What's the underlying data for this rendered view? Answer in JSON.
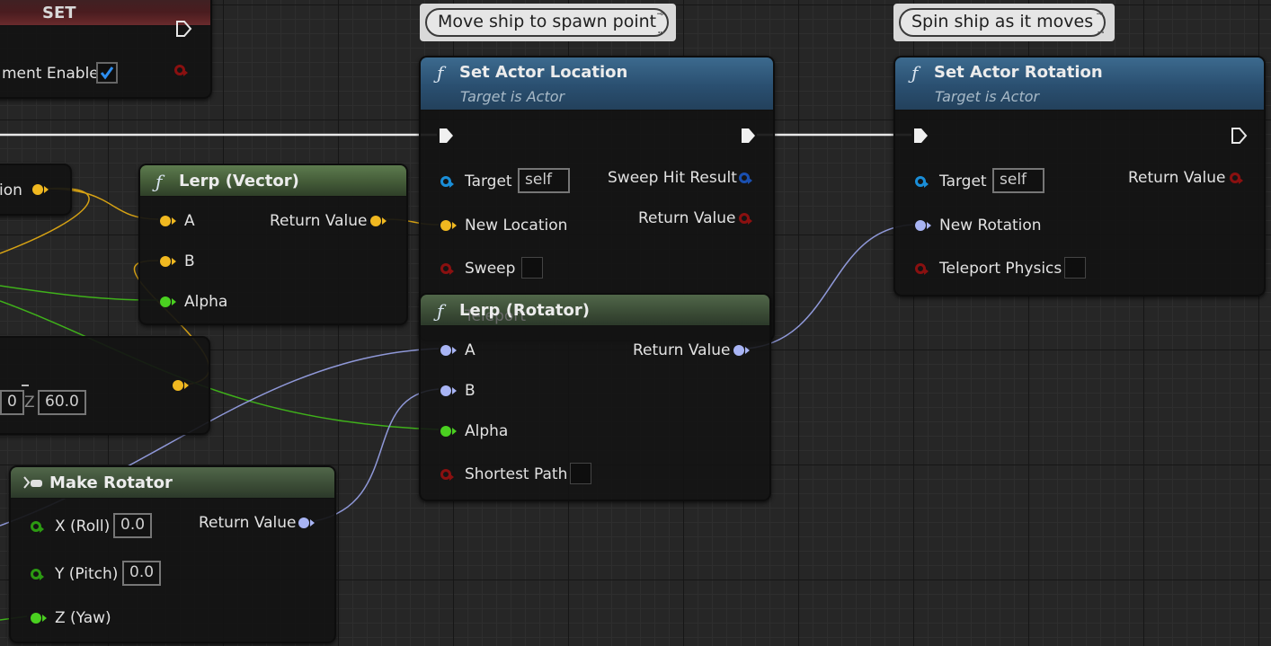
{
  "colors": {
    "exec": "#ffffff",
    "vector": "#f0b820",
    "rotator": "#a8b4f4",
    "float": "#4ad020",
    "object": "#1a8ed8",
    "boolean": "#8a1010"
  },
  "comments": [
    {
      "text": "Move ship to spawn point",
      "pin_icon": "pin-icon",
      "more_icon": "ellipsis-icon"
    },
    {
      "text": "Spin ship as it moves",
      "pin_icon": "pin-icon",
      "more_icon": "ellipsis-icon"
    }
  ],
  "set_node": {
    "title": "SET",
    "pin_label": "ment Enabled",
    "checked": true
  },
  "partial_node": {
    "pin_label": "ion"
  },
  "vector_partial": {
    "z_label": "Z",
    "z_value": "60.0",
    "prev_value": "0"
  },
  "lerp_vector": {
    "icon": "function-icon",
    "title": "Lerp (Vector)",
    "inputs": [
      "A",
      "B",
      "Alpha"
    ],
    "output": "Return Value"
  },
  "set_actor_location": {
    "icon": "function-icon",
    "title": "Set Actor Location",
    "subtitle": "Target is Actor",
    "target_label": "Target",
    "target_value": "self",
    "new_location": "New Location",
    "sweep": "Sweep",
    "teleport_ghost": "Teleport",
    "out_sweep": "Sweep Hit Result",
    "out_return": "Return Value"
  },
  "set_actor_rotation": {
    "icon": "function-icon",
    "title": "Set Actor Rotation",
    "subtitle": "Target is Actor",
    "target_label": "Target",
    "target_value": "self",
    "new_rotation": "New Rotation",
    "teleport": "Teleport Physics",
    "out_return": "Return Value"
  },
  "lerp_rotator": {
    "icon": "function-icon",
    "title": "Lerp (Rotator)",
    "a": "A",
    "b": "B",
    "alpha": "Alpha",
    "shortest": "Shortest Path",
    "output": "Return Value"
  },
  "make_rotator": {
    "icon": "make-struct-icon",
    "title": "Make Rotator",
    "x_label": "X (Roll)",
    "x_value": "0.0",
    "y_label": "Y (Pitch)",
    "y_value": "0.0",
    "z_label": "Z (Yaw)",
    "output": "Return Value"
  }
}
